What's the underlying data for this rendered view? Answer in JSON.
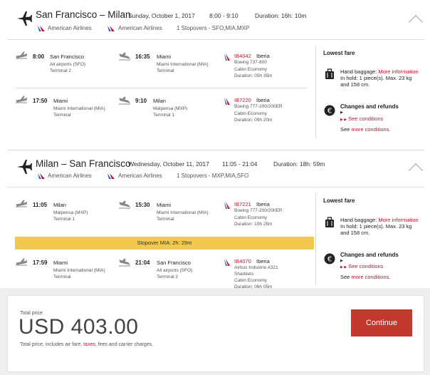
{
  "outbound": {
    "title": "San Francisco – Milan",
    "date": "Sunday, October 1, 2017",
    "time": "8:00 - 9:10",
    "duration": "Duration: 16h: 10m",
    "airline1": "American Airlines",
    "airline2": "American Airlines",
    "stops": "1 Stopovers - SFO,MIA,MXP",
    "legs": [
      {
        "dep_time": "8:00",
        "dep_city": "San Francisco",
        "dep_airport": "All airports (SFO)",
        "dep_terminal": "Terminal 2",
        "arr_time": "16:35",
        "arr_city": "Miami",
        "arr_airport": "Miami International (MIA)",
        "arr_terminal": "Terminal",
        "flight_code": "IB4042",
        "airline": "Iberia",
        "aircraft": "Boeing 737-800",
        "cabin": "Cabin Economy",
        "duration": "Duration: 05h 35m"
      },
      {
        "dep_time": "17:50",
        "dep_city": "Miami",
        "dep_airport": "Miami International (MIA)",
        "dep_terminal": "Terminal",
        "arr_time": "9:10",
        "arr_city": "Milan",
        "arr_airport": "Malpensa (MXP)",
        "arr_terminal": "Terminal 1",
        "flight_code": "IB7220",
        "airline": "Iberia",
        "aircraft": "Boeing 777-200/200ER",
        "cabin": "Cabin Economy",
        "duration": "Duration: 09h 20m"
      }
    ],
    "fare": {
      "title": "Lowest fare",
      "baggage_label": "Hand baggage:",
      "more_info": "More information",
      "baggage_detail": "In hold: 1 piece(s). Max. 23 kg and 158 cm.",
      "changes_title": "Changes and refunds",
      "see_conditions": "See conditions",
      "see_label": "See",
      "more_conditions": "more conditions."
    }
  },
  "inbound": {
    "title": "Milan – San Francisco",
    "date": "Wednesday, October 11, 2017",
    "time": "11:05 - 21:04",
    "duration": "Duration: 18h: 59m",
    "airline1": "American Airlines",
    "airline2": "American Airlines",
    "stops": "1 Stopovers - MXP,MIA,SFO",
    "legs": [
      {
        "dep_time": "11:05",
        "dep_city": "Milan",
        "dep_airport": "Malpensa (MXP)",
        "dep_terminal": "Terminal 1",
        "arr_time": "15:30",
        "arr_city": "Miami",
        "arr_airport": "Miami International (MIA)",
        "arr_terminal": "Terminal",
        "flight_code": "IB7221",
        "airline": "Iberia",
        "aircraft": "Boeing 777-200/200ER",
        "cabin": "Cabin Economy",
        "duration": "Duration: 10h 25m"
      },
      {
        "dep_time": "17:59",
        "dep_city": "Miami",
        "dep_airport": "Miami International (MIA)",
        "dep_terminal": "Terminal",
        "arr_time": "21:04",
        "arr_city": "San Francisco",
        "arr_airport": "All airports (SFO)",
        "arr_terminal": "Terminal 2",
        "flight_code": "IB4070",
        "airline": "Iberia",
        "aircraft": "Airbus Industrie A321 Sharklets",
        "cabin": "Cabin Economy",
        "duration": "Duration: 06h 05m"
      }
    ],
    "stopover": "Stopover MIA: 2h: 29m",
    "fare": {
      "title": "Lowest fare",
      "baggage_label": "Hand baggage:",
      "more_info": "More information",
      "baggage_detail": "In hold: 1 piece(s). Max. 23 kg and 158 cm.",
      "changes_title": "Changes and refunds",
      "see_conditions": "See conditions",
      "see_label": "See",
      "more_conditions": "more conditions."
    }
  },
  "total": {
    "label": "Total price",
    "price": "USD 403.00",
    "note_before": "Total price, includes air fare,",
    "taxes": "taxes",
    "note_after": ", fees and carrier charges.",
    "continue_label": "Continue"
  },
  "colors": {
    "accent_red": "#c8102e",
    "stopover_yellow": "#f2c94c",
    "button_red": "#c0392b"
  },
  "icons": [
    "plane-icon",
    "takeoff-icon",
    "landing-icon",
    "aa-logo-icon",
    "iberia-logo-icon",
    "luggage-icon",
    "euro-icon",
    "chevron-up-icon"
  ]
}
